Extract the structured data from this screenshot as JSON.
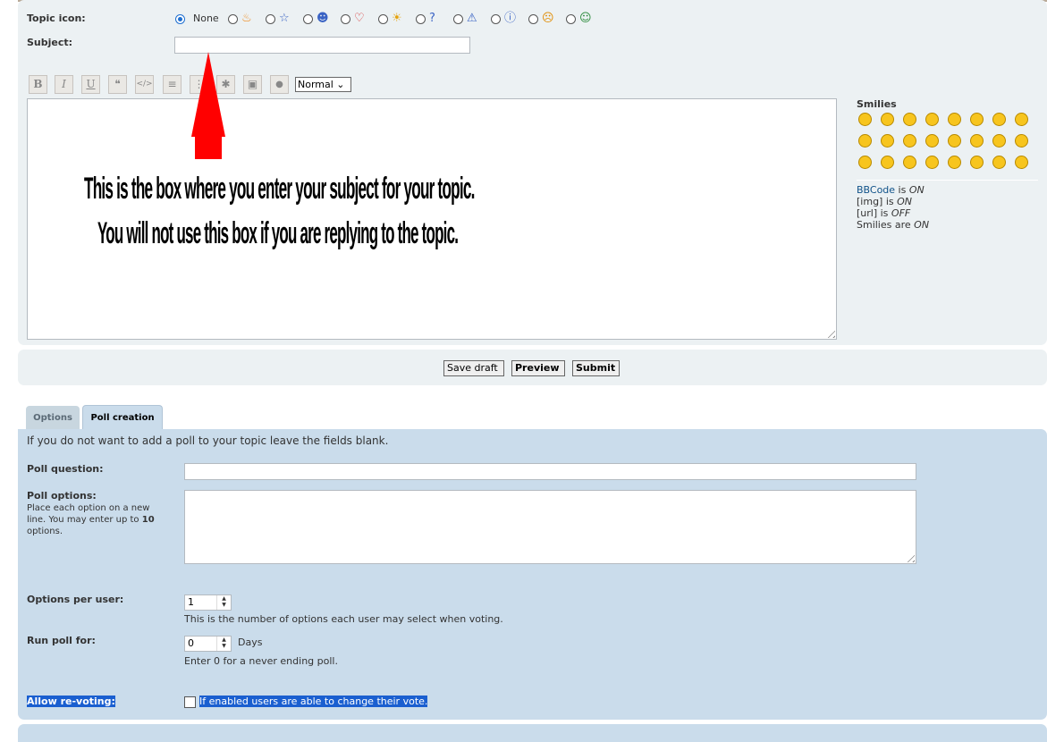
{
  "topic_icon": {
    "label": "Topic icon:",
    "none_label": "None",
    "options": [
      "fire-icon",
      "star-icon",
      "smiley-icon",
      "heart-icon",
      "sun-icon",
      "question-icon",
      "warning-icon",
      "info-icon",
      "surprised-icon",
      "grin-icon"
    ]
  },
  "subject": {
    "label": "Subject:",
    "value": ""
  },
  "toolbar": {
    "bold": "B",
    "italic": "I",
    "underline": "U",
    "quote": "❝",
    "code": "</>",
    "list": "≡",
    "list_numbered": "⋮",
    "asterisk": "✱",
    "image": "▣",
    "color": "●",
    "font_size": "Normal ⌄"
  },
  "annotation": {
    "line1": "This is the box where you enter your subject for your topic.",
    "line2": "You will not use this box if you are replying to the topic."
  },
  "smilies": {
    "title": "Smilies",
    "faces": [
      "😄",
      "😀",
      "😉",
      "😁",
      "😮",
      "😳",
      "😯",
      "😎",
      "😆",
      "😵",
      "😜",
      "😡",
      "😒",
      "😈",
      "😹",
      "😏",
      "❗",
      "❓",
      "💡",
      "➡",
      "😐",
      "😬",
      "🤓",
      "🤓"
    ]
  },
  "status": {
    "bbcode_link": "BBCode",
    "bbcode_rest": " is ",
    "bbcode_val": "ON",
    "img_label": "[img] is ",
    "img_val": "ON",
    "url_label": "[url] is ",
    "url_val": "OFF",
    "smilies_label": "Smilies are ",
    "smilies_val": "ON"
  },
  "buttons": {
    "save_draft": "Save draft",
    "preview": "Preview",
    "submit": "Submit"
  },
  "tabs": {
    "options": "Options",
    "poll_creation": "Poll creation"
  },
  "poll": {
    "intro": "If you do not want to add a poll to your topic leave the fields blank.",
    "question_label": "Poll question:",
    "options_label": "Poll options:",
    "options_help_1": "Place each option on a new",
    "options_help_2": "line. You may enter up to ",
    "options_help_max": "10",
    "options_help_3": "options.",
    "per_user_label": "Options per user:",
    "per_user_value": "1",
    "per_user_help": "This is the number of options each user may select when voting.",
    "run_label": "Run poll for:",
    "run_value": "0",
    "run_unit": "Days",
    "run_help": "Enter 0 for a never ending poll.",
    "revote_label": "Allow re-voting:",
    "revote_help": " If enabled users are able to change their vote. "
  }
}
